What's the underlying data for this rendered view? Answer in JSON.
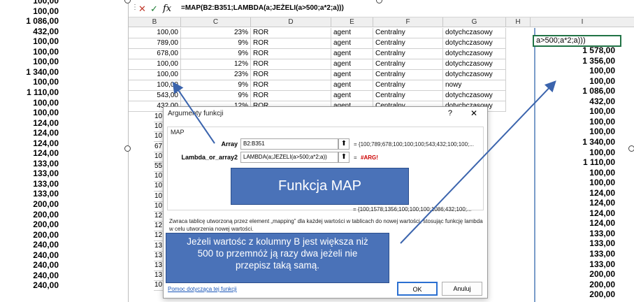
{
  "left_values": [
    "100,00",
    "100,00",
    "1 086,00",
    "432,00",
    "100,00",
    "100,00",
    "100,00",
    "1 340,00",
    "100,00",
    "1 110,00",
    "100,00",
    "100,00",
    "124,00",
    "124,00",
    "124,00",
    "124,00",
    "133,00",
    "133,00",
    "133,00",
    "133,00",
    "200,00",
    "200,00",
    "200,00",
    "200,00",
    "240,00",
    "240,00",
    "240,00",
    "240,00",
    "240,00"
  ],
  "formula_bar": {
    "cancel": "✕",
    "confirm": "✓",
    "fx": "fx",
    "formula": "=MAP(B2:B351;LAMBDA(a;JEŻELI(a>500;a*2;a)))"
  },
  "columns": [
    "B",
    "C",
    "D",
    "E",
    "F",
    "G",
    "H",
    "I"
  ],
  "rows": [
    [
      "100,00",
      "23%",
      "ROR",
      "agent",
      "Centralny",
      "dotychczasowy"
    ],
    [
      "789,00",
      "9%",
      "ROR",
      "agent",
      "Centralny",
      "dotychczasowy"
    ],
    [
      "678,00",
      "9%",
      "ROR",
      "agent",
      "Centralny",
      "dotychczasowy"
    ],
    [
      "100,00",
      "12%",
      "ROR",
      "agent",
      "Centralny",
      "dotychczasowy"
    ],
    [
      "100,00",
      "23%",
      "ROR",
      "agent",
      "Centralny",
      "dotychczasowy"
    ],
    [
      "100,00",
      "9%",
      "ROR",
      "agent",
      "Centralny",
      "nowy"
    ],
    [
      "543,00",
      "9%",
      "ROR",
      "agent",
      "Centralny",
      "dotychczasowy"
    ],
    [
      "432,00",
      "12%",
      "ROR",
      "agent",
      "Centralny",
      "dotychczasowy"
    ]
  ],
  "partial_b": [
    "10",
    "10",
    "10",
    "67",
    "10",
    "55",
    "10",
    "10",
    "10",
    "10",
    "12",
    "12",
    "12",
    "13",
    "13",
    "13",
    "13",
    "10"
  ],
  "active_cell_text": "a>500;a*2;a)))",
  "col_i_values": [
    "1 578,00",
    "1 356,00",
    "100,00",
    "100,00",
    "1 086,00",
    "432,00",
    "100,00",
    "100,00",
    "100,00",
    "1 340,00",
    "100,00",
    "1 110,00",
    "100,00",
    "100,00",
    "124,00",
    "124,00",
    "124,00",
    "124,00",
    "133,00",
    "133,00",
    "133,00",
    "133,00",
    "200,00",
    "200,00",
    "200,00"
  ],
  "dialog": {
    "title": "Argumenty funkcji",
    "help_mark": "?",
    "close": "✕",
    "group": "MAP",
    "arg1_label": "Array",
    "arg1_value": "B2:B351",
    "arg1_result": "= {100;789;678;100;100;100;543;432;100;100;...",
    "arg2_label": "Lambda_or_array2",
    "arg2_value": "LAMBDA(a;JEŻELI(a>500;a*2;a))",
    "arg2_result_eq": "=",
    "arg2_result": "#ARG!",
    "result_line": "= {100;1578;1356;100;100;100;1086;432;100;...",
    "description": "Zwraca tablicę utworzoną przez element „mapping” dla każdej wartości w tablicach do nowej wartości, stosując funkcję lambda w celu utworzenia nowej wartości.",
    "v_label": "V",
    "help_link": "Pomoc dotycząca tej funkcji",
    "ok": "OK",
    "cancel": "Anuluj"
  },
  "callout_title": "Funkcja MAP",
  "callout_note": "Jeżeli wartośc z kolumny B jest większa niż 500 to przemnóż ją razy dwa jeżeli nie przepisz taką samą.",
  "colors": {
    "callout": "#4a72b8",
    "active_border": "#217346",
    "error": "#cc0000"
  }
}
